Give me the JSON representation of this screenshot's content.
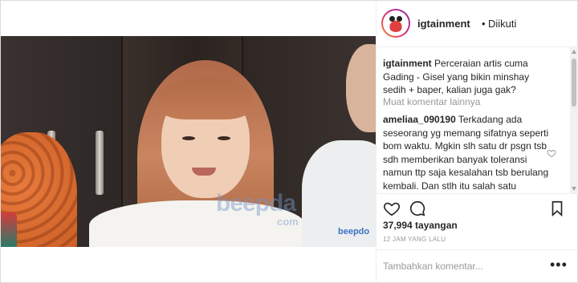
{
  "post": {
    "username": "igtainment",
    "separator": "•",
    "follow_status": "Diikuti",
    "caption_user": "igtainment",
    "caption_text": "Perceraian artis cuma Gading - Gisel yang bikin minshay sedih + baper, kalian juga gak?",
    "load_more": "Muat komentar lainnya",
    "comment_user": "ameliaa_090190",
    "comment_text": "Terkadang ada seseorang yg memang sifatnya seperti bom waktu. Mgkin slh satu dr psgn tsb sdh memberikan banyak toleransi namun ttp saja kesalahan tsb berulang kembali. Dan stlh itu salah satu psngan menyatakan bahwa oke kesempatanmu sudah habis, tidak ada lagi",
    "views": "37,994 tayangan",
    "time": "12 JAM YANG LALU",
    "add_comment_placeholder": "Tambahkan komentar...",
    "more_options": "•••"
  },
  "video": {
    "watermark": "beepda",
    "watermark_sub": "com",
    "shirt_brand": "beepdo"
  },
  "icons": [
    "heart-icon",
    "comment-icon",
    "bookmark-icon",
    "small-heart-icon"
  ]
}
